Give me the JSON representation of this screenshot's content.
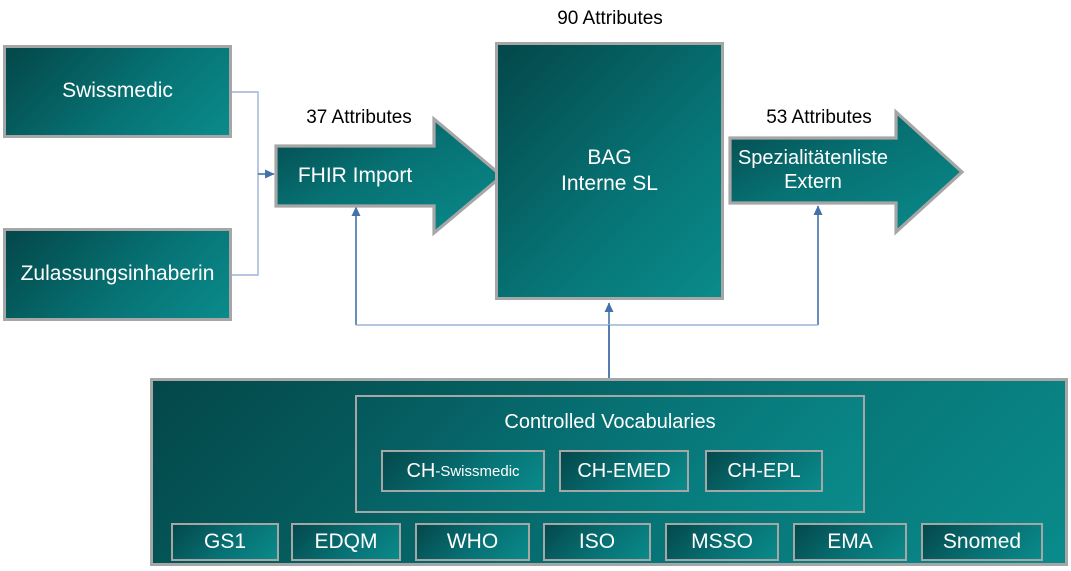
{
  "diagram": {
    "title": "BAG Spezialitaetenliste data flow",
    "colors": {
      "teal_dark": "#04474a",
      "teal_light": "#0a8b8b",
      "border_gray": "#a6a6a6",
      "connector_blue": "#4472a8",
      "label_text": "#000000",
      "box_text": "#ffffff"
    },
    "sources": [
      {
        "label": "Swissmedic",
        "name": "swissmedic"
      },
      {
        "label": "Zulassungsinhaberin",
        "name": "zulassungsinhaberin"
      }
    ],
    "labels": {
      "attributes_37": "37 Attributes",
      "attributes_90": "90 Attributes",
      "attributes_53": "53 Attributes"
    },
    "process": {
      "import_arrow": "FHIR Import",
      "central_box_line1": "BAG",
      "central_box_line2": "Interne SL",
      "export_arrow_line1": "Spezialitätenliste",
      "export_arrow_line2": "Extern"
    },
    "vocabulary_panel": {
      "controlled_vocabularies_title": "Controlled Vocabularies",
      "profiles": [
        {
          "prefix": "CH",
          "suffix": "-Swissmedic",
          "label": "CH-Swissmedic"
        },
        {
          "prefix": "CH-EMED",
          "suffix": "",
          "label": "CH-EMED"
        },
        {
          "prefix": "CH-EPL",
          "suffix": "",
          "label": "CH-EPL"
        }
      ],
      "standards": [
        "GS1",
        "EDQM",
        "WHO",
        "ISO",
        "MSSO",
        "EMA",
        "Snomed"
      ]
    }
  }
}
